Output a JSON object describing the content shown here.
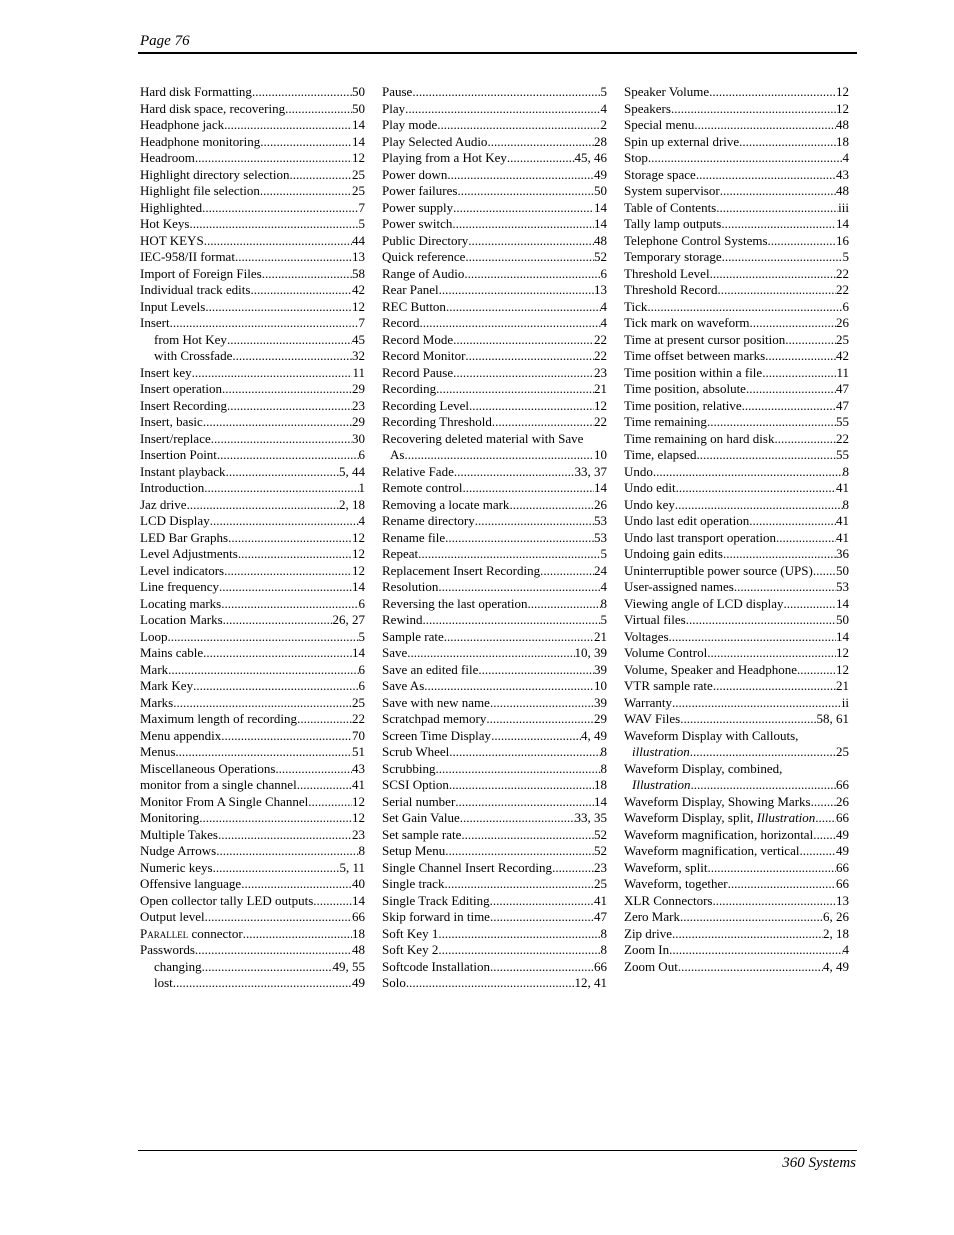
{
  "header": {
    "title": "Page 76"
  },
  "footer": {
    "text": "360 Systems"
  },
  "columns": [
    [
      {
        "term": "Hard disk Formatting",
        "pages": "50"
      },
      {
        "term": "Hard disk space, recovering",
        "pages": "50"
      },
      {
        "term": "Headphone jack",
        "pages": "14"
      },
      {
        "term": "Headphone monitoring",
        "pages": "14"
      },
      {
        "term": "Headroom",
        "pages": "12"
      },
      {
        "term": "Highlight directory selection",
        "pages": "25"
      },
      {
        "term": "Highlight file selection",
        "pages": "25"
      },
      {
        "term": "Highlighted",
        "pages": "7"
      },
      {
        "term": "Hot Keys",
        "pages": "5"
      },
      {
        "term": "HOT KEYS",
        "pages": "44"
      },
      {
        "term": "IEC-958/II format",
        "pages": "13"
      },
      {
        "term": "Import of Foreign Files",
        "pages": "58"
      },
      {
        "term": "Individual track edits",
        "pages": "42"
      },
      {
        "term": "Input Levels",
        "pages": "12"
      },
      {
        "term": "Insert",
        "pages": "7"
      },
      {
        "term": "from Hot Key",
        "pages": "45",
        "sub": true
      },
      {
        "term": "with Crossfade",
        "pages": "32",
        "sub": true
      },
      {
        "term": "Insert key",
        "pages": "11"
      },
      {
        "term": "Insert operation",
        "pages": "29"
      },
      {
        "term": "Insert Recording",
        "pages": "23"
      },
      {
        "term": "Insert, basic",
        "pages": "29"
      },
      {
        "term": "Insert/replace",
        "pages": "30"
      },
      {
        "term": "Insertion Point",
        "pages": "6"
      },
      {
        "term": "Instant playback",
        "pages": "5, 44"
      },
      {
        "term": "Introduction",
        "pages": "1"
      },
      {
        "term": "Jaz drive",
        "pages": "2, 18"
      },
      {
        "term": "LCD Display",
        "pages": "4"
      },
      {
        "term": "LED Bar Graphs",
        "pages": "12"
      },
      {
        "term": "Level Adjustments",
        "pages": "12"
      },
      {
        "term": "Level indicators",
        "pages": "12"
      },
      {
        "term": "Line frequency",
        "pages": "14"
      },
      {
        "term": "Locating marks",
        "pages": "6"
      },
      {
        "term": "Location Marks",
        "pages": "26, 27"
      },
      {
        "term": "Loop",
        "pages": "5"
      },
      {
        "term": "Mains cable",
        "pages": "14"
      },
      {
        "term": "Mark",
        "pages": "6"
      },
      {
        "term": "Mark Key",
        "pages": "6"
      },
      {
        "term": "Marks",
        "pages": "25"
      },
      {
        "term": "Maximum length of recording",
        "pages": "22"
      },
      {
        "term": "Menu appendix",
        "pages": "70"
      },
      {
        "term": "Menus",
        "pages": "51"
      },
      {
        "term": "Miscellaneous Operations",
        "pages": "43"
      },
      {
        "term": "monitor from a single channel",
        "pages": "41"
      },
      {
        "term": "Monitor From A Single Channel",
        "pages": "12"
      },
      {
        "term": "Monitoring",
        "pages": "12"
      },
      {
        "term": "Multiple Takes",
        "pages": "23"
      },
      {
        "term": "Nudge Arrows",
        "pages": "8"
      },
      {
        "term": "Numeric keys",
        "pages": "5, 11"
      },
      {
        "term": "Offensive language",
        "pages": "40"
      },
      {
        "term": "Open collector tally LED outputs",
        "pages": "14"
      },
      {
        "term": "Output level",
        "pages": "66"
      },
      {
        "term": "Parallel connector",
        "pages": "18",
        "smallcaps_word": "Parallel"
      },
      {
        "term": "Passwords",
        "pages": "48"
      },
      {
        "term": "changing",
        "pages": "49, 55",
        "sub": true
      },
      {
        "term": "lost",
        "pages": "49",
        "sub": true
      }
    ],
    [
      {
        "term": "Pause",
        "pages": "5"
      },
      {
        "term": "Play",
        "pages": "4"
      },
      {
        "term": "Play mode",
        "pages": "2"
      },
      {
        "term": "Play Selected Audio",
        "pages": "28"
      },
      {
        "term": "Playing from a Hot Key",
        "pages": "45, 46"
      },
      {
        "term": "Power down",
        "pages": "49"
      },
      {
        "term": "Power failures",
        "pages": "50"
      },
      {
        "term": "Power supply",
        "pages": "14"
      },
      {
        "term": "Power switch",
        "pages": "14"
      },
      {
        "term": "Public Directory",
        "pages": "48"
      },
      {
        "term": "Quick reference",
        "pages": "52"
      },
      {
        "term": "Range of Audio",
        "pages": "6"
      },
      {
        "term": "Rear Panel",
        "pages": "13"
      },
      {
        "term": "REC Button",
        "pages": "4"
      },
      {
        "term": "Record",
        "pages": "4"
      },
      {
        "term": "Record Mode",
        "pages": "22"
      },
      {
        "term": "Record Monitor",
        "pages": "22"
      },
      {
        "term": "Record Pause",
        "pages": "23"
      },
      {
        "term": "Recording",
        "pages": "21"
      },
      {
        "term": "Recording Level",
        "pages": "12"
      },
      {
        "term": "Recording Threshold",
        "pages": "22"
      },
      {
        "term": "Recovering deleted material with Save",
        "pages": "",
        "heading_only": true
      },
      {
        "term": "As",
        "pages": "10",
        "cont": true
      },
      {
        "term": "Relative Fade",
        "pages": "33, 37"
      },
      {
        "term": "Remote control",
        "pages": "14"
      },
      {
        "term": "Removing a locate mark",
        "pages": "26"
      },
      {
        "term": "Rename directory",
        "pages": "53"
      },
      {
        "term": "Rename file",
        "pages": "53"
      },
      {
        "term": "Repeat",
        "pages": "5"
      },
      {
        "term": "Replacement Insert Recording",
        "pages": "24"
      },
      {
        "term": "Resolution",
        "pages": "4"
      },
      {
        "term": "Reversing the last operation",
        "pages": "8"
      },
      {
        "term": "Rewind",
        "pages": "5"
      },
      {
        "term": "Sample rate",
        "pages": "21"
      },
      {
        "term": "Save",
        "pages": "10, 39"
      },
      {
        "term": "Save an edited file",
        "pages": "39"
      },
      {
        "term": "Save As",
        "pages": "10"
      },
      {
        "term": "Save with new name",
        "pages": "39"
      },
      {
        "term": "Scratchpad memory",
        "pages": "29"
      },
      {
        "term": "Screen Time Display",
        "pages": "4, 49"
      },
      {
        "term": "Scrub Wheel",
        "pages": "8"
      },
      {
        "term": "Scrubbing",
        "pages": "8"
      },
      {
        "term": "SCSI Option",
        "pages": "18"
      },
      {
        "term": "Serial number",
        "pages": "14"
      },
      {
        "term": "Set Gain Value",
        "pages": "33, 35"
      },
      {
        "term": "Set sample rate",
        "pages": "52"
      },
      {
        "term": "Setup Menu",
        "pages": "52"
      },
      {
        "term": "Single Channel Insert Recording",
        "pages": "23"
      },
      {
        "term": "Single track",
        "pages": "25"
      },
      {
        "term": "Single Track Editing",
        "pages": "41"
      },
      {
        "term": "Skip forward in time",
        "pages": "47"
      },
      {
        "term": "Soft Key 1",
        "pages": "8"
      },
      {
        "term": "Soft Key 2",
        "pages": "8"
      },
      {
        "term": "Softcode Installation",
        "pages": "66"
      },
      {
        "term": "Solo",
        "pages": "12, 41"
      }
    ],
    [
      {
        "term": "Speaker Volume",
        "pages": "12"
      },
      {
        "term": "Speakers",
        "pages": "12"
      },
      {
        "term": "Special menu",
        "pages": "48"
      },
      {
        "term": "Spin up external drive",
        "pages": "18"
      },
      {
        "term": "Stop",
        "pages": "4"
      },
      {
        "term": "Storage space",
        "pages": "43"
      },
      {
        "term": "System supervisor",
        "pages": "48"
      },
      {
        "term": "Table of Contents",
        "pages": "iii"
      },
      {
        "term": "Tally lamp outputs",
        "pages": "14"
      },
      {
        "term": "Telephone Control Systems",
        "pages": "16"
      },
      {
        "term": "Temporary storage",
        "pages": "5"
      },
      {
        "term": "Threshold Level",
        "pages": "22"
      },
      {
        "term": "Threshold Record",
        "pages": "22"
      },
      {
        "term": "Tick",
        "pages": "6"
      },
      {
        "term": "Tick mark on waveform",
        "pages": "26"
      },
      {
        "term": "Time at present cursor position",
        "pages": "25"
      },
      {
        "term": "Time offset between marks",
        "pages": "42"
      },
      {
        "term": "Time position within a file",
        "pages": "11"
      },
      {
        "term": "Time position, absolute",
        "pages": "47"
      },
      {
        "term": "Time position, relative",
        "pages": "47"
      },
      {
        "term": "Time remaining",
        "pages": "55"
      },
      {
        "term": "Time remaining on hard disk",
        "pages": "22"
      },
      {
        "term": "Time, elapsed",
        "pages": "55"
      },
      {
        "term": "Undo",
        "pages": "8"
      },
      {
        "term": "Undo edit",
        "pages": "41"
      },
      {
        "term": "Undo key",
        "pages": "8"
      },
      {
        "term": "Undo last edit operation",
        "pages": "41"
      },
      {
        "term": "Undo last transport operation",
        "pages": "41"
      },
      {
        "term": "Undoing gain edits",
        "pages": "36"
      },
      {
        "term": "Uninterruptible power source (UPS)",
        "pages": "50"
      },
      {
        "term": "User-assigned names",
        "pages": "53"
      },
      {
        "term": "Viewing angle of LCD display",
        "pages": "14"
      },
      {
        "term": "Virtual files",
        "pages": "50"
      },
      {
        "term": "Voltages",
        "pages": "14"
      },
      {
        "term": "Volume Control",
        "pages": "12"
      },
      {
        "term": "Volume, Speaker and Headphone",
        "pages": "12"
      },
      {
        "term": "VTR sample rate",
        "pages": "21"
      },
      {
        "term": "Warranty",
        "pages": "ii"
      },
      {
        "term": "WAV Files",
        "pages": "58, 61"
      },
      {
        "term": "Waveform Display with Callouts,",
        "pages": "",
        "heading_only": true
      },
      {
        "term": "illustration",
        "pages": "25",
        "cont": true,
        "italic": true
      },
      {
        "term": "Waveform Display, combined,",
        "pages": "",
        "heading_only": true
      },
      {
        "term": "Illustration",
        "pages": "66",
        "cont": true,
        "italic": true
      },
      {
        "term": "Waveform Display, Showing Marks",
        "pages": "26"
      },
      {
        "term": "Waveform Display, split, ",
        "italic_suffix": "Illustration",
        "pages": "66"
      },
      {
        "term": "Waveform magnification, horizontal",
        "pages": "49"
      },
      {
        "term": "Waveform magnification, vertical",
        "pages": "49"
      },
      {
        "term": "Waveform, split",
        "pages": "66"
      },
      {
        "term": "Waveform, together",
        "pages": "66"
      },
      {
        "term": "XLR Connectors",
        "pages": "13"
      },
      {
        "term": "Zero Mark",
        "pages": "6, 26"
      },
      {
        "term": "Zip drive",
        "pages": "2, 18"
      },
      {
        "term": "Zoom In",
        "pages": "4"
      },
      {
        "term": "Zoom Out",
        "pages": "4, 49"
      }
    ]
  ]
}
